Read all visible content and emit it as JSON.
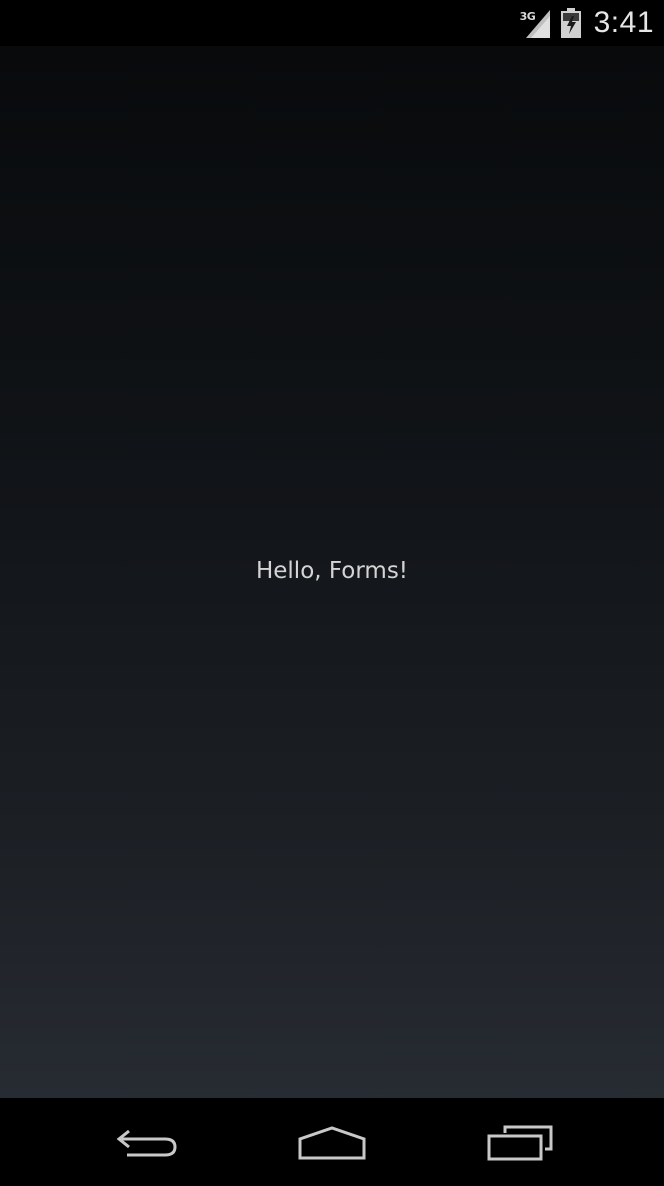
{
  "status_bar": {
    "network_type": "3G",
    "signal_icon": "signal-icon",
    "battery_icon": "battery-icon",
    "time": "3:41"
  },
  "app": {
    "main_label": "Hello, Forms!"
  },
  "nav_bar": {
    "back_icon": "back-icon",
    "home_icon": "home-icon",
    "recent_apps_icon": "recent-apps-icon"
  },
  "colors": {
    "status_bar_bg": "#000000",
    "content_top": "#080a0c",
    "content_bottom": "#272b32",
    "label_text": "#d4d4d4",
    "nav_icon": "#c8c8c8"
  }
}
